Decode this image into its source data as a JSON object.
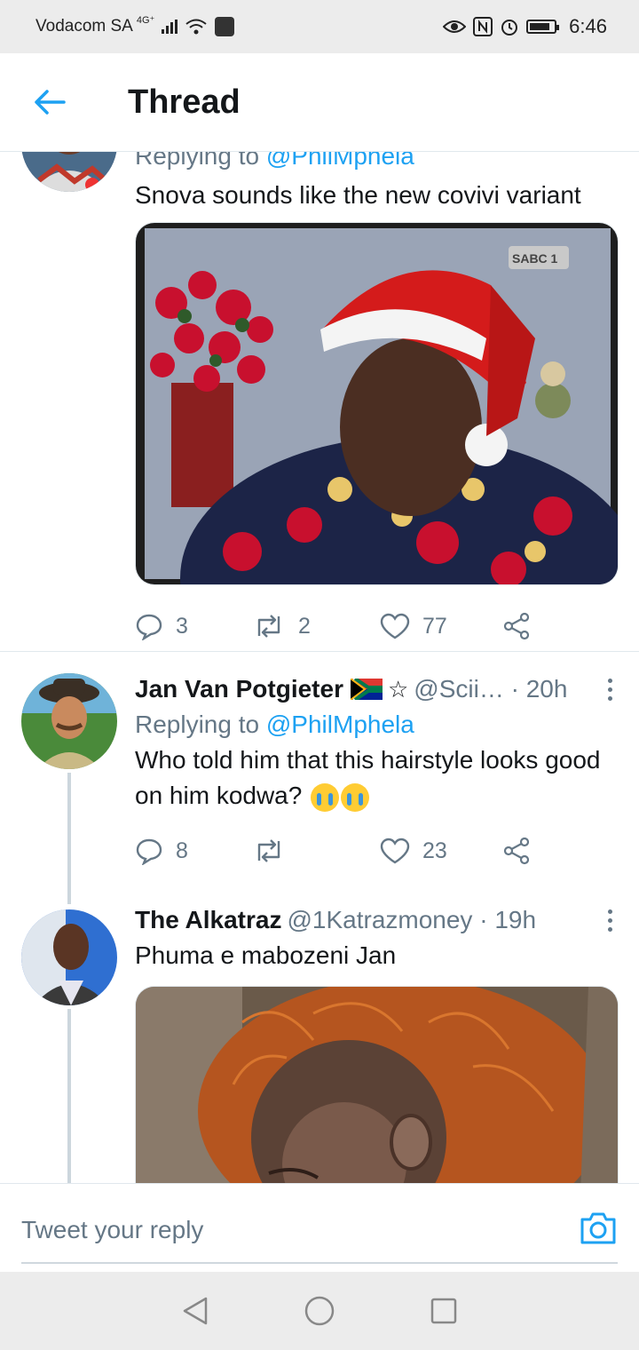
{
  "status_bar": {
    "carrier": "Vodacom SA",
    "network": "4G⁺",
    "time": "6:46",
    "battery_level": 0.85
  },
  "header": {
    "title": "Thread",
    "back_icon": "arrow-left-icon",
    "accent": "#1da1f2"
  },
  "tweets": [
    {
      "replying_to_label": "Replying to",
      "replying_to": "@PhilMphela",
      "text": "Snova sounds like the new covivi variant",
      "media_logo": "SABC 1",
      "replies": "3",
      "retweets": "2",
      "likes": "77"
    },
    {
      "name": "Jan Van Potgieter",
      "handle_time": "@Scii… · 20h",
      "replying_to_label": "Replying to",
      "replying_to": "@PhilMphela",
      "text": "Who told him that this hairstyle looks good on him kodwa?",
      "replies": "8",
      "retweets": "",
      "likes": "23"
    },
    {
      "name": "The Alkatraz",
      "handle_time": "@1Katrazmoney · 19h",
      "text": "Phuma e mabozeni Jan"
    }
  ],
  "reply_bar": {
    "placeholder": "Tweet your reply",
    "camera_icon": "camera-icon"
  },
  "colors": {
    "text": "#14171a",
    "secondary": "#657786",
    "link": "#1da1f2",
    "border": "#e1e8ed"
  }
}
